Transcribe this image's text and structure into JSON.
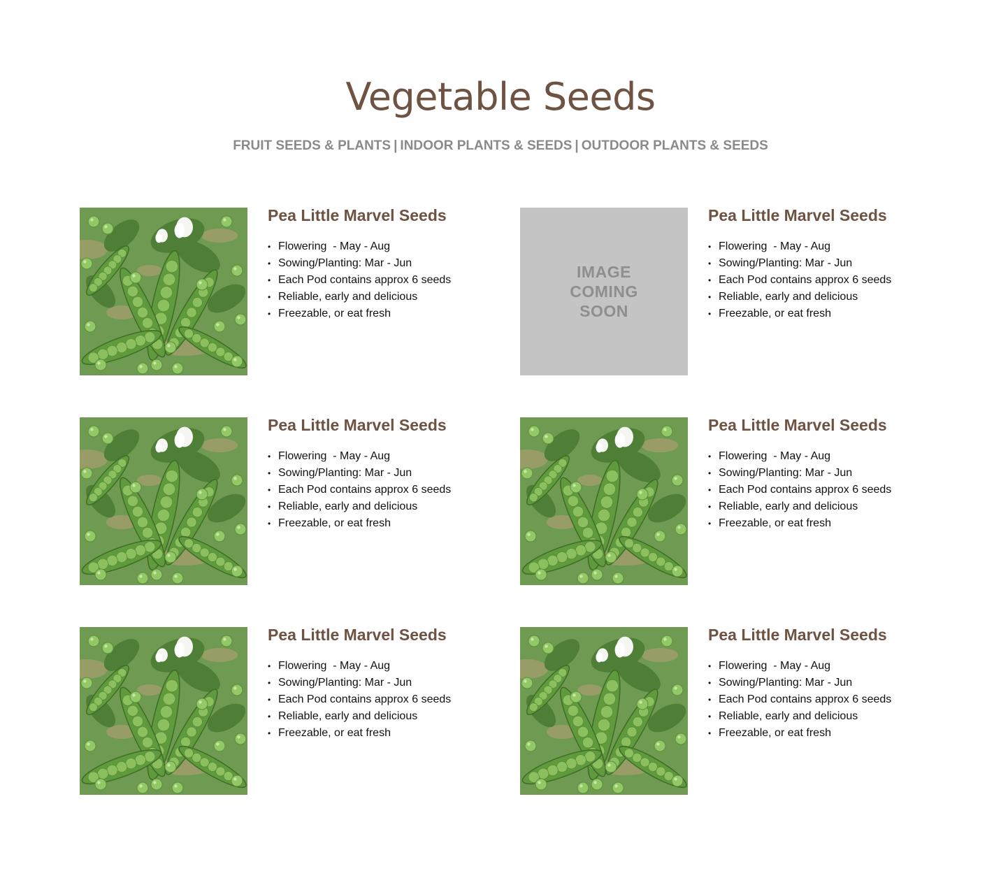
{
  "page": {
    "title": "Vegetable Seeds"
  },
  "nav": {
    "links": [
      {
        "label": "FRUIT SEEDS & PLANTS"
      },
      {
        "label": "INDOOR PLANTS & SEEDS"
      },
      {
        "label": "OUTDOOR PLANTS & SEEDS"
      }
    ],
    "separator": "|"
  },
  "products": [
    {
      "title": "Pea Little Marvel Seeds",
      "image": "pea-pods-photo",
      "features": [
        "Flowering  - May - Aug",
        "Sowing/Planting: Mar - Jun",
        "Each Pod contains approx 6 seeds",
        "Reliable, early and delicious",
        "Freezable, or eat fresh"
      ]
    },
    {
      "title": "Pea Little Marvel Seeds",
      "image": "placeholder",
      "placeholder_text": "IMAGE COMING SOON",
      "features": [
        "Flowering  - May - Aug",
        "Sowing/Planting: Mar - Jun",
        "Each Pod contains approx 6 seeds",
        "Reliable, early and delicious",
        "Freezable, or eat fresh"
      ]
    },
    {
      "title": "Pea Little Marvel Seeds",
      "image": "pea-pods-photo",
      "features": [
        "Flowering  - May - Aug",
        "Sowing/Planting: Mar - Jun",
        "Each Pod contains approx 6 seeds",
        "Reliable, early and delicious",
        "Freezable, or eat fresh"
      ]
    },
    {
      "title": "Pea Little Marvel Seeds",
      "image": "pea-pods-photo",
      "features": [
        "Flowering  - May - Aug",
        "Sowing/Planting: Mar - Jun",
        "Each Pod contains approx 6 seeds",
        "Reliable, early and delicious",
        "Freezable, or eat fresh"
      ]
    },
    {
      "title": "Pea Little Marvel Seeds",
      "image": "pea-pods-photo",
      "features": [
        "Flowering  - May - Aug",
        "Sowing/Planting: Mar - Jun",
        "Each Pod contains approx 6 seeds",
        "Reliable, early and delicious",
        "Freezable, or eat fresh"
      ]
    },
    {
      "title": "Pea Little Marvel Seeds",
      "image": "pea-pods-photo",
      "features": [
        "Flowering  - May - Aug",
        "Sowing/Planting: Mar - Jun",
        "Each Pod contains approx 6 seeds",
        "Reliable, early and delicious",
        "Freezable, or eat fresh"
      ]
    }
  ],
  "colors": {
    "heading": "#6e5242",
    "nav_text": "#8a8a8a",
    "placeholder_bg": "#c4c4c4",
    "placeholder_text": "#8e8e8e",
    "body_text": "#111111"
  }
}
